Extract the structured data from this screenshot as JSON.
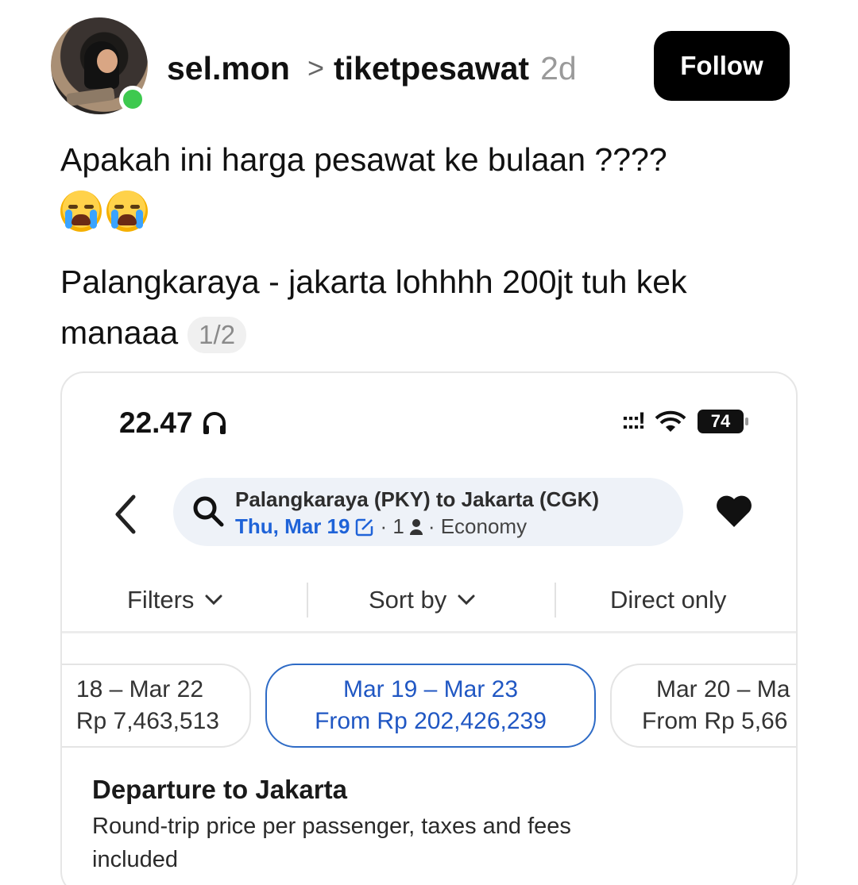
{
  "post": {
    "username": "sel.mon",
    "separator": ">",
    "topic": "tiketpesawat",
    "age": "2d",
    "follow_label": "Follow",
    "text_line1": "Apakah ini harga pesawat ke bulaan ????",
    "text_line2": "Palangkaraya - jakarta lohhhh 200jt tuh kek",
    "text_line3": "manaaa",
    "page_indicator": "1/2"
  },
  "screenshot": {
    "status_time": "22.47",
    "battery": "74",
    "route": "Palangkaraya (PKY) to Jakarta (CGK)",
    "date": "Thu, Mar 19",
    "passengers": "· 1",
    "cabin": "· Economy",
    "tabs": {
      "filters": "Filters",
      "sort": "Sort by",
      "direct": "Direct only"
    },
    "date_options": [
      {
        "range": "18 – Mar 22",
        "price": "Rp 7,463,513"
      },
      {
        "range": "Mar 19 – Mar 23",
        "price": "From Rp 202,426,239"
      },
      {
        "range": "Mar 20 – Ma",
        "price": "From Rp 5,66"
      }
    ],
    "section_title": "Departure to Jakarta",
    "section_subtitle": "Round-trip price per passenger, taxes and fees included"
  }
}
